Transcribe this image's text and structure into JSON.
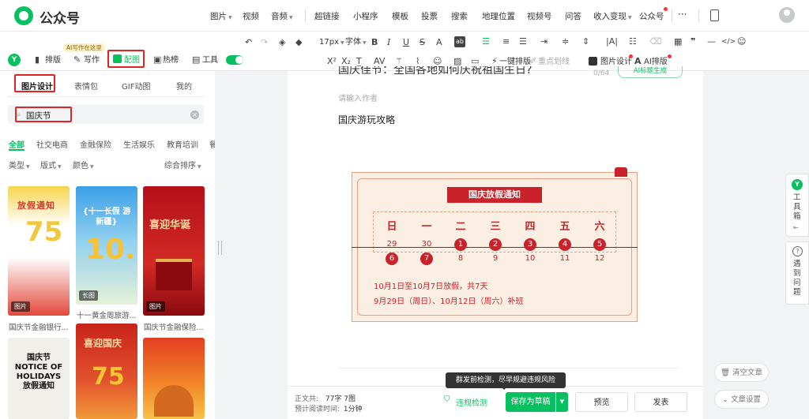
{
  "app": {
    "name": "公众号"
  },
  "top_menu": {
    "image": "图片",
    "video": "视频",
    "audio": "音频",
    "hyperlink": "超链接",
    "miniprogram": "小程序",
    "template": "模板",
    "vote": "投票",
    "search": "搜索",
    "location": "地理位置",
    "channels": "视频号",
    "qa": "问答",
    "monetize": "收入变现",
    "official": "公众号",
    "more": "···"
  },
  "toolbar": {
    "mode_layout": "排版",
    "mode_write": "写作",
    "mode_image": "配图",
    "mode_hot": "热榜",
    "mode_tools": "工具",
    "ai_badge": "AI写作在这里",
    "font_size": "17px",
    "font": "字体",
    "one_click": "一键排版",
    "highlight": "重点划线",
    "image_design": "图片设计",
    "ai_layout": "AI排版"
  },
  "left_panel": {
    "tabs": [
      "图片设计",
      "表情包",
      "GIF动图",
      "我的"
    ],
    "search_value": "国庆节",
    "categories": [
      "全部",
      "社交电商",
      "金融保险",
      "生活娱乐",
      "教育培训",
      "餐"
    ],
    "filters": [
      "类型",
      "版式",
      "颜色"
    ],
    "sort": "综合排序",
    "thumbs": [
      {
        "badge": "图片",
        "caption": "国庆节金融银行...",
        "text": "放假通知"
      },
      {
        "badge": "长图",
        "caption": "十一黄金周旅游...",
        "text": "{十一长假 游新疆}"
      },
      {
        "badge": "图片",
        "caption": "国庆节金融保险...",
        "text": "喜迎华诞"
      },
      {
        "badge": "",
        "caption": "",
        "text": "国庆节 NOTICE OF HOLIDAYS 放假通知"
      },
      {
        "badge": "",
        "caption": "",
        "text": "喜迎国庆"
      },
      {
        "badge": "",
        "caption": "",
        "text": ""
      }
    ]
  },
  "editor": {
    "title": "国庆佳节：全国各地如何庆祝祖国生日?",
    "title_count": "0/64",
    "ai_title": "AI标题生成",
    "author_placeholder": "请输入作者",
    "body_text": "国庆游玩攻略",
    "calendar": {
      "title": "国庆放假通知",
      "weekdays": [
        "日",
        "一",
        "二",
        "三",
        "四",
        "五",
        "六"
      ],
      "row1": [
        "29",
        "30",
        "1",
        "2",
        "3",
        "4",
        "5"
      ],
      "row2": [
        "6",
        "7",
        "8",
        "9",
        "10",
        "11",
        "12"
      ],
      "note1": "10月1日至10月7日放假，共7天",
      "note2": "9月29日（周日）、10月12日（周六）补班"
    }
  },
  "bottom": {
    "word_count_label": "正文共:",
    "word_count_value": "77字 7图",
    "read_time_label": "预计阅读时间:",
    "read_time_value": "1分钟",
    "check": "违规检测",
    "tooltip": "群发前检测，尽早规避违规风险",
    "save_draft": "保存为草稿",
    "preview": "预览",
    "publish": "发表"
  },
  "side_tools": {
    "toolbox": "工具箱",
    "help": "遇到问题",
    "clear": "清空文章",
    "settings": "文章设置"
  },
  "colors": {
    "brand_green": "#07c160",
    "highlight_red": "#e02424",
    "calendar_red": "#c8232b"
  }
}
